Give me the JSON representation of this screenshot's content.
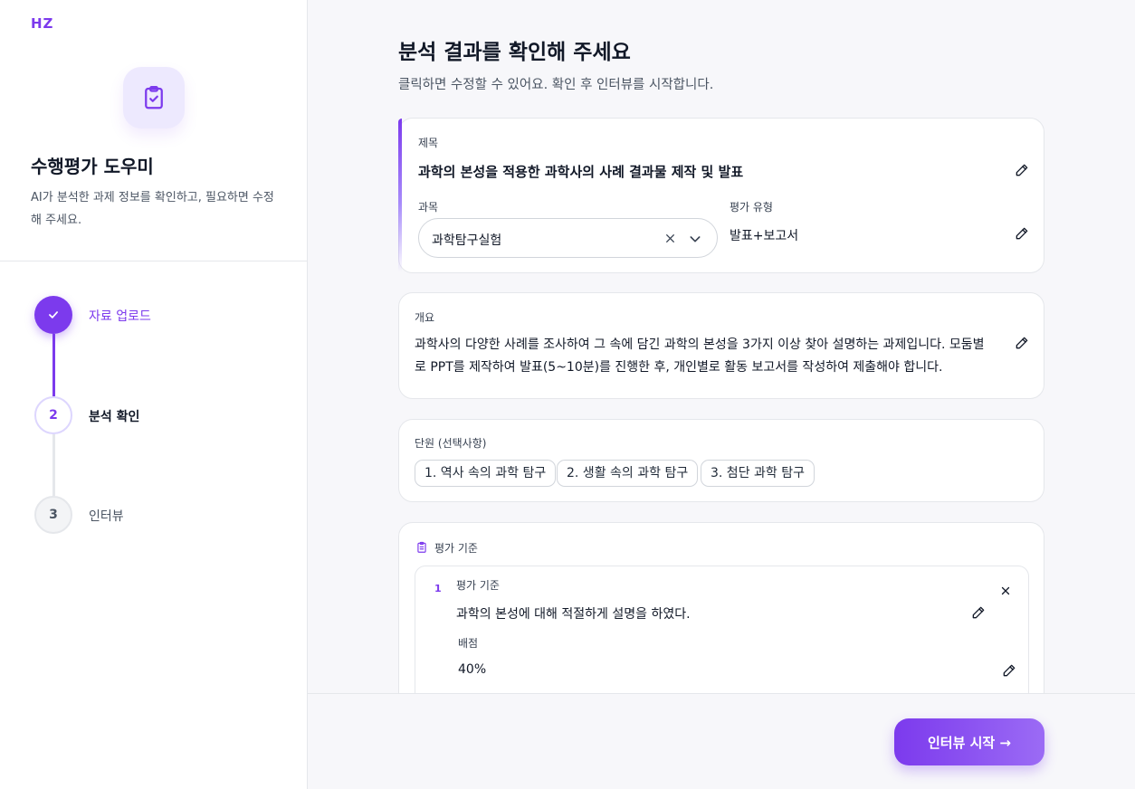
{
  "brand": {
    "logo": "HZ",
    "accent": "#7c3aed"
  },
  "sidebar": {
    "app_title": "수행평가 도우미",
    "app_desc": "AI가 분석한 과제 정보를 확인하고, 필요하면 수정해 주세요.",
    "steps": [
      {
        "number": "1",
        "label": "자료 업로드",
        "status": "completed"
      },
      {
        "number": "2",
        "label": "분석 확인",
        "status": "current"
      },
      {
        "number": "3",
        "label": "인터뷰",
        "status": "upcoming"
      }
    ]
  },
  "main": {
    "title": "분석 결과를 확인해 주세요",
    "subtitle": "클릭하면 수정할 수 있어요. 확인 후 인터뷰를 시작합니다.",
    "title_card": {
      "title_label": "제목",
      "title_value": "과학의 본성을 적용한 과학사의 사례 결과물 제작 및 발표",
      "subject_label": "과목",
      "subject_value": "과학탐구실험",
      "eval_type_label": "평가 유형",
      "eval_type_value": "발표+보고서"
    },
    "overview_card": {
      "label": "개요",
      "text": "과학사의 다양한 사례를 조사하여 그 속에 담긴 과학의 본성을 3가지 이상 찾아 설명하는 과제입니다. 모둠별로 PPT를 제작하여 발표(5~10분)를 진행한 후, 개인별로 활동 보고서를 작성하여 제출해야 합니다."
    },
    "unit_card": {
      "label": "단원 (선택사항)",
      "units": [
        "1. 역사 속의 과학 탐구",
        "2. 생활 속의 과학 탐구",
        "3. 첨단 과학 탐구"
      ]
    },
    "criteria_card": {
      "label": "평가 기준",
      "items": [
        {
          "number": "1",
          "criterion_label": "평가 기준",
          "criterion_value": "과학의 본성에 대해 적절하게 설명을 하였다.",
          "score_label": "배점",
          "score_value": "40%"
        }
      ]
    }
  },
  "footer": {
    "start_button": "인터뷰 시작 →"
  }
}
